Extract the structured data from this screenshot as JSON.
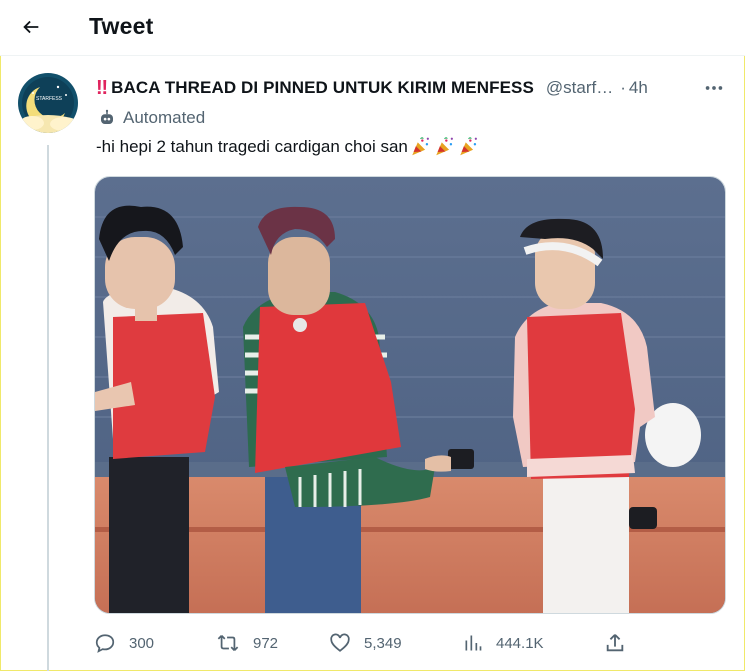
{
  "header": {
    "title": "Tweet"
  },
  "tweet": {
    "alert_emoji": "‼️",
    "display_name": "BACA THREAD DI PINNED UNTUK KIRIM MENFESS",
    "handle": "@starf…",
    "separator": "·",
    "time": "4h",
    "automated_label": "Automated",
    "text": "-hi hepi 2 tahun tragedi cardigan choi san",
    "avatar_text": "STARFESS",
    "media_icon": "photo-three-people-red-bibs"
  },
  "actions": {
    "replies": "300",
    "retweets": "972",
    "likes": "5,349",
    "views": "444.1K"
  },
  "colors": {
    "accent": "#e0245e",
    "secondary_text": "#536471",
    "primary_text": "#0f1419",
    "avatar_bg": "#12506b",
    "moon": "#f3dd7a"
  }
}
